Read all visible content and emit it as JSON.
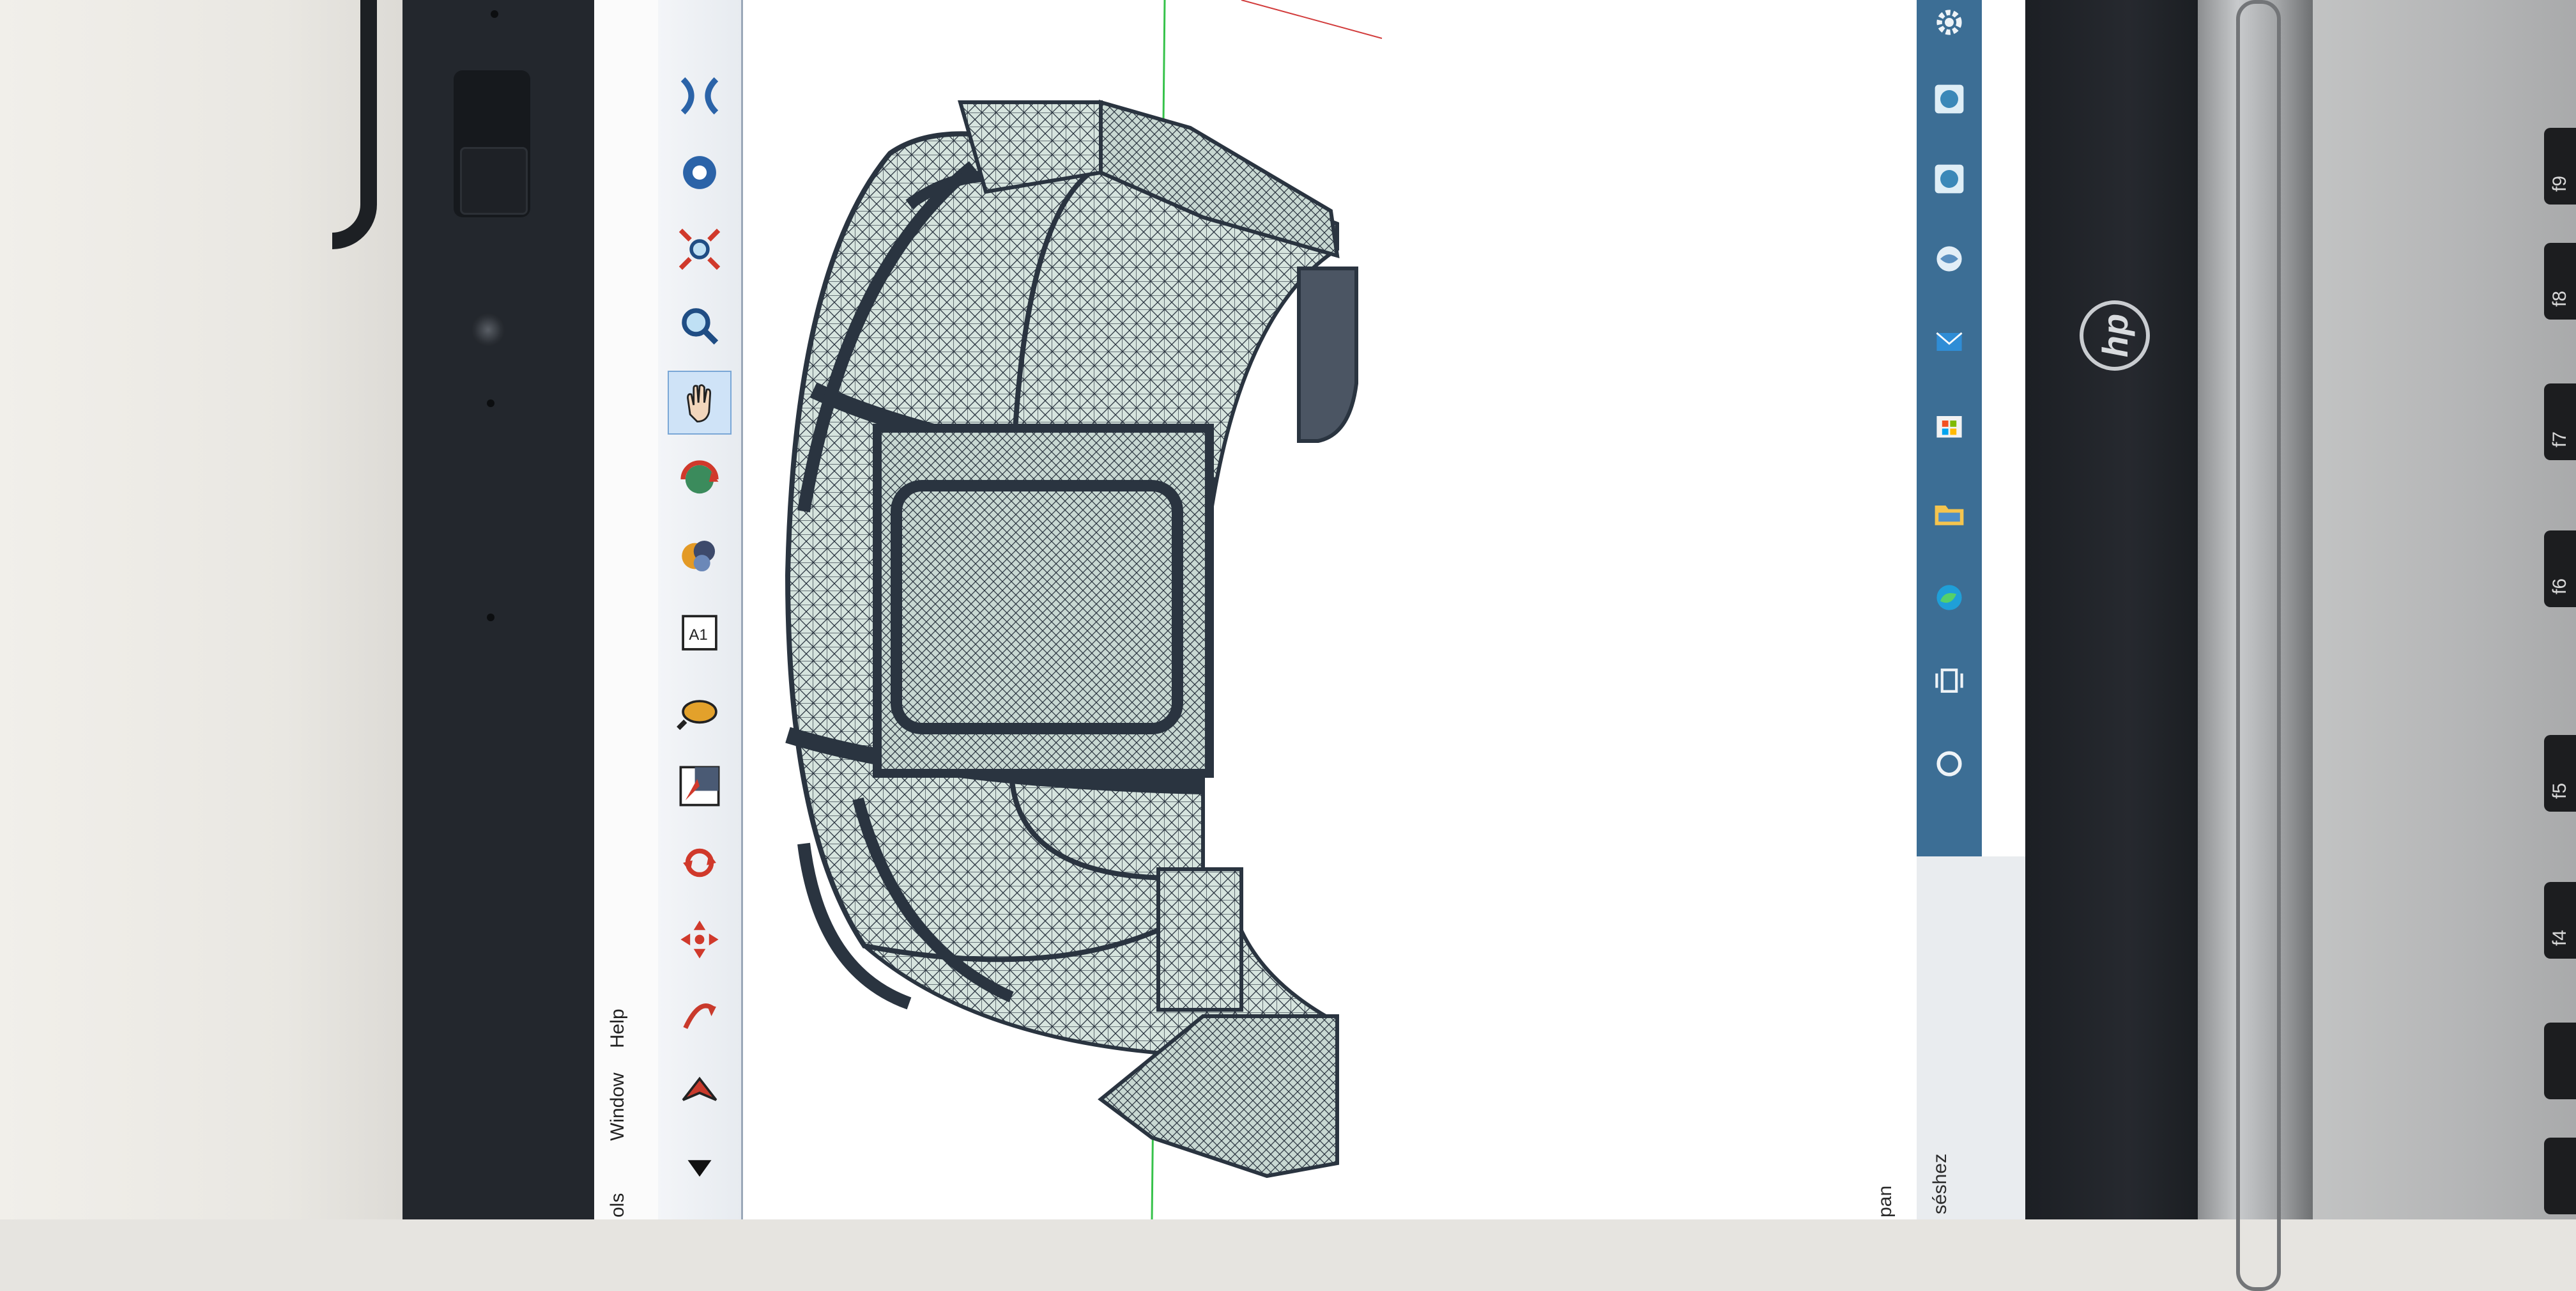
{
  "menu": {
    "items": [
      "ols",
      "Window",
      "Help"
    ]
  },
  "toolbar": {
    "tools": [
      "dropdown-arrow-icon",
      "select-arrow-icon",
      "fly-icon",
      "move-icon",
      "rotate-icon",
      "zoom-window-icon",
      "light-icon",
      "label-icon",
      "color-icon",
      "rotate-view-icon",
      "pan-hand-icon",
      "zoom-icon",
      "fit-icon",
      "mesh-tool-1-icon",
      "mesh-tool-2-icon",
      "mesh-tool-3-icon",
      "mesh-tool-4-icon"
    ]
  },
  "status": {
    "line1": "pan",
    "line2": "séshez"
  },
  "taskbar": {
    "icons": [
      "settings-icon",
      "app-mesh-icon-1",
      "app-mesh-icon-2",
      "app-globe-icon",
      "mail-icon",
      "store-icon",
      "folder-icon",
      "edge-icon",
      "task-view-icon",
      "search-circle-icon"
    ]
  },
  "brand": {
    "logo_text": "hp"
  },
  "keyboard": {
    "keys": [
      "f9",
      "f8",
      "f7",
      "f6",
      "f5",
      "f4"
    ]
  },
  "colors": {
    "mesh_fill": "#cfe0da",
    "mesh_line": "#2a3440",
    "taskbar": "#3c6e95",
    "active_tool": "#cfe3f7",
    "axis_green": "#36c24a",
    "axis_red": "#d23c3c"
  }
}
